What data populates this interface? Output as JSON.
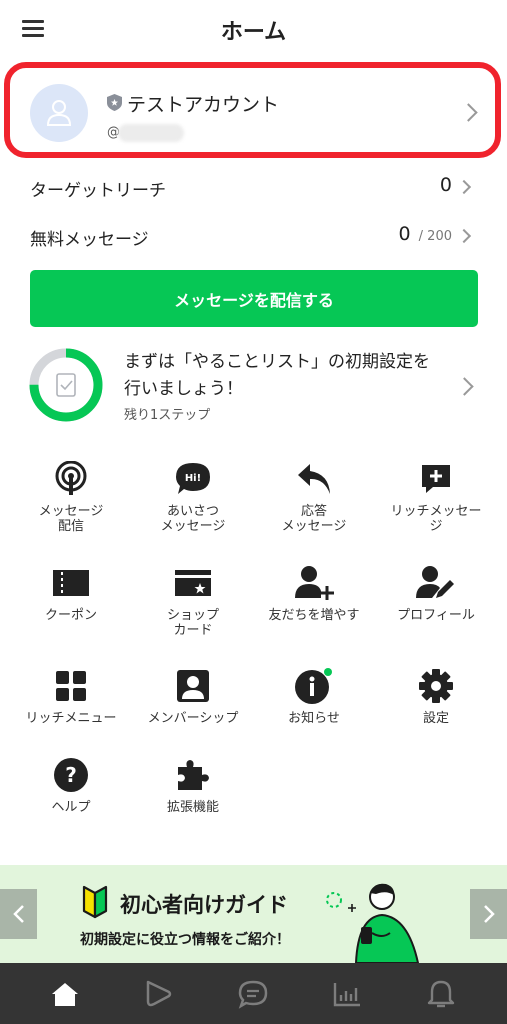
{
  "header": {
    "title": "ホーム",
    "menu_icon": "hamburger-menu-icon"
  },
  "account": {
    "name": "テストアカウント",
    "id_prefix": "@",
    "avatar_icon": "user-icon",
    "badge_icon": "shield-star-icon"
  },
  "stats": [
    {
      "label": "ターゲットリーチ",
      "value": "0",
      "max": ""
    },
    {
      "label": "無料メッセージ",
      "value": "0",
      "max": "/ 200"
    }
  ],
  "cta": {
    "label": "メッセージを配信する",
    "color": "#06c755"
  },
  "todo": {
    "title": "まずは「やることリスト」の初期設定を行いましょう！",
    "subtitle": "残り1ステップ",
    "progress": 0.75
  },
  "grid": [
    {
      "label": "メッセージ\n配信",
      "icon": "broadcast-icon"
    },
    {
      "label": "あいさつ\nメッセージ",
      "icon": "greeting-bubble-icon"
    },
    {
      "label": "応答\nメッセージ",
      "icon": "reply-icon"
    },
    {
      "label": "リッチメッセー\nジ",
      "icon": "rich-message-icon"
    },
    {
      "label": "クーポン",
      "icon": "coupon-icon"
    },
    {
      "label": "ショップ\nカード",
      "icon": "shop-card-icon"
    },
    {
      "label": "友だちを増やす",
      "icon": "add-friend-icon"
    },
    {
      "label": "プロフィール",
      "icon": "profile-edit-icon"
    },
    {
      "label": "リッチメニュー",
      "icon": "rich-menu-icon"
    },
    {
      "label": "メンバーシップ",
      "icon": "membership-icon"
    },
    {
      "label": "お知らせ",
      "icon": "info-icon"
    },
    {
      "label": "設定",
      "icon": "gear-icon"
    },
    {
      "label": "ヘルプ",
      "icon": "help-icon"
    },
    {
      "label": "拡張機能",
      "icon": "puzzle-icon"
    }
  ],
  "banner": {
    "title": "初心者向けガイド",
    "subtitle": "初期設定に役立つ情報をご紹介！"
  },
  "tabs": [
    {
      "name": "home",
      "icon": "home-icon",
      "active": true
    },
    {
      "name": "voom",
      "icon": "play-icon",
      "active": false
    },
    {
      "name": "chat",
      "icon": "chat-icon",
      "active": false
    },
    {
      "name": "analytics",
      "icon": "bar-chart-icon",
      "active": false
    },
    {
      "name": "notifications",
      "icon": "bell-icon",
      "active": false
    }
  ]
}
